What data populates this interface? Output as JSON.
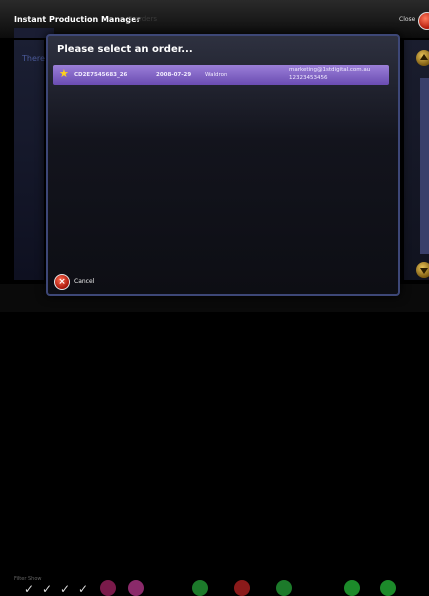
{
  "app": {
    "title": "Instant Production Manager",
    "subtitle": "3 orders",
    "close_label": "Close"
  },
  "background": {
    "left_text": "There",
    "filter_label": "Filter Show"
  },
  "dialog": {
    "title": "Please select an order...",
    "orders": [
      {
        "id": "CD2E7545683_26",
        "date": "2008-07-29",
        "name": "Waldron",
        "email": "marketing@1stdigital.com.au",
        "phone": "12323453456"
      }
    ],
    "cancel_label": "Cancel"
  },
  "colors": {
    "accent": "#6a4cb2",
    "dialog_border": "#3d4777",
    "star": "#ffd21a",
    "cancel": "#c0200f"
  },
  "icons": [
    "star-icon",
    "cancel-icon",
    "close-icon",
    "scroll-up-icon",
    "scroll-down-icon"
  ]
}
